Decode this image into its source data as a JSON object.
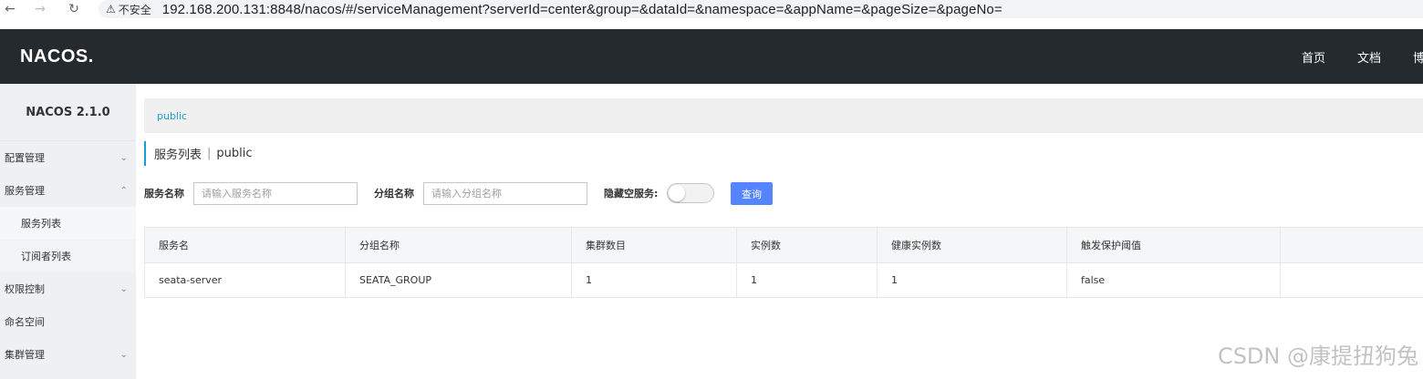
{
  "browser": {
    "security_label": "不安全",
    "url": "192.168.200.131:8848/nacos/#/serviceManagement?serverId=center&group=&dataId=&namespace=&appName=&pageSize=&pageNo="
  },
  "header": {
    "logo": "NACOS.",
    "nav": [
      "首页",
      "文档",
      "博"
    ]
  },
  "sidebar": {
    "title": "NACOS 2.1.0",
    "items": [
      {
        "label": "配置管理",
        "chevron": "down"
      },
      {
        "label": "服务管理",
        "chevron": "up"
      },
      {
        "label": "服务列表",
        "sub": true,
        "active": true
      },
      {
        "label": "订阅者列表",
        "sub": true
      },
      {
        "label": "权限控制",
        "chevron": "down"
      },
      {
        "label": "命名空间"
      },
      {
        "label": "集群管理",
        "chevron": "down"
      }
    ]
  },
  "breadcrumb": {
    "namespace": "public"
  },
  "page": {
    "title": "服务列表",
    "separator": "|",
    "namespace": "public"
  },
  "filters": {
    "service_name_label": "服务名称",
    "service_name_placeholder": "请输入服务名称",
    "group_name_label": "分组名称",
    "group_name_placeholder": "请输入分组名称",
    "hide_empty_label": "隐藏空服务:",
    "query_label": "查询"
  },
  "table": {
    "columns": [
      "服务名",
      "分组名称",
      "集群数目",
      "实例数",
      "健康实例数",
      "触发保护阈值",
      ""
    ],
    "rows": [
      [
        "seata-server",
        "SEATA_GROUP",
        "1",
        "1",
        "1",
        "false",
        ""
      ]
    ]
  },
  "watermark": "CSDN @康提扭狗兔",
  "colors": {
    "header_bg": "#252a2f",
    "sidebar_bg": "#eef1f4",
    "accent": "#1aa0d4",
    "primary_button": "#5584ff"
  }
}
